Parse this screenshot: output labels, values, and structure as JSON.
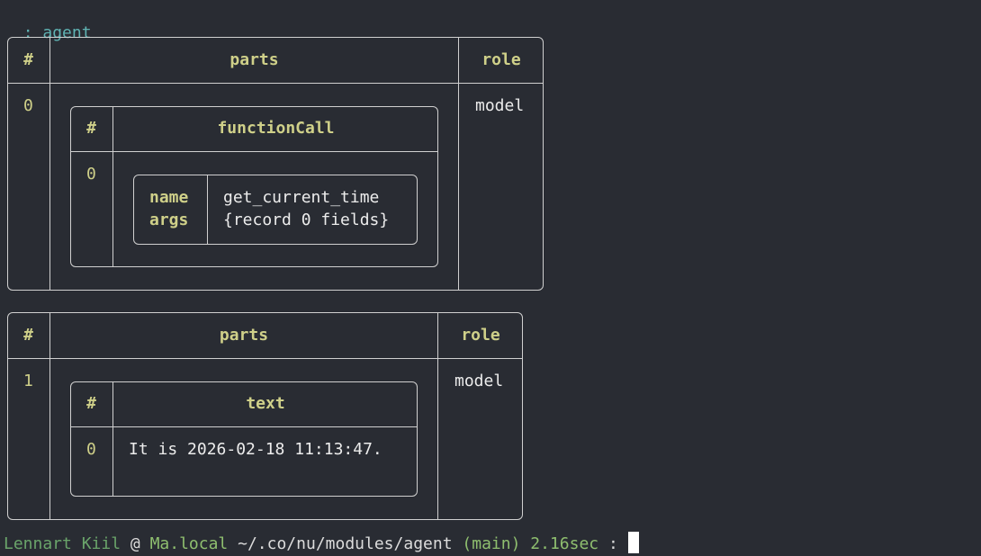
{
  "command": {
    "prefix": ":",
    "text": "agent"
  },
  "table1": {
    "headers": {
      "index": "#",
      "parts": "parts",
      "role": "role"
    },
    "row": {
      "index": "0",
      "role": "model"
    },
    "inner": {
      "headers": {
        "index": "#",
        "column": "functionCall"
      },
      "row_index": "0",
      "record": {
        "keys": [
          "name",
          "args"
        ],
        "values": [
          "get_current_time",
          "{record 0 fields}"
        ]
      }
    }
  },
  "table2": {
    "headers": {
      "index": "#",
      "parts": "parts",
      "role": "role"
    },
    "row": {
      "index": "1",
      "role": "model"
    },
    "inner": {
      "headers": {
        "index": "#",
        "column": "text"
      },
      "row_index": "0",
      "value": "It is 2026-02-18 11:13:47."
    }
  },
  "prompt": {
    "user": "Lennart Kiil",
    "at": "@",
    "host": "Ma.local",
    "path_prefix": "~/.co/nu/modules/",
    "path_last": "agent",
    "branch": "(main)",
    "duration": "2.16sec",
    "symbol": ":"
  }
}
